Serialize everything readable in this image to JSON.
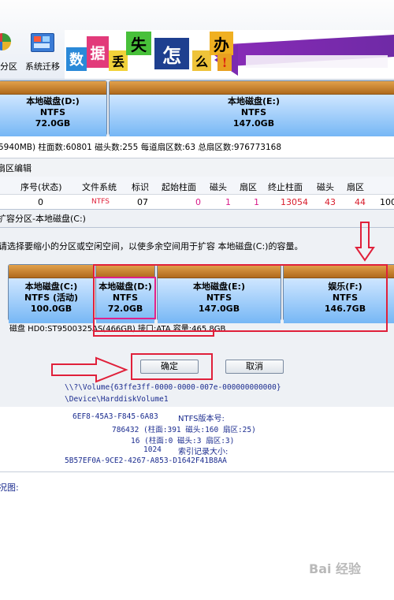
{
  "toolbar": {
    "partition_label": "分区",
    "migrate_label": "系统迁移",
    "banner_chars": [
      "数",
      "据",
      "丢",
      "失",
      "怎",
      "么",
      "办",
      "!"
    ]
  },
  "disk_top": {
    "partitions": [
      {
        "name": "本地磁盘(D:)",
        "fs": "NTFS",
        "size": "72.0GB"
      },
      {
        "name": "本地磁盘(E:)",
        "fs": "NTFS",
        "size": "147.0GB"
      }
    ]
  },
  "disk_info": "5940MB)   柱面数:60801   磁头数:255   每道扇区数:63   总扇区数:976773168",
  "tab_label": "扇区编辑",
  "table": {
    "headers": [
      "序号(状态)",
      "文件系统",
      "标识",
      "起始柱面",
      "磁头",
      "扇区",
      "终止柱面",
      "磁头",
      "扇区"
    ],
    "row": [
      "0",
      "NTFS",
      "07",
      "0",
      "1",
      "1",
      "13054",
      "43",
      "44",
      "100"
    ]
  },
  "dialog": {
    "title": "扩容分区-本地磁盘(C:)",
    "instruction": "请选择要缩小的分区或空闲空间，以使多余空间用于扩容 本地磁盘(C:)的容量。",
    "partitions": [
      {
        "name": "本地磁盘(C:)",
        "fs": "NTFS (活动)",
        "size": "100.0GB"
      },
      {
        "name": "本地磁盘(D:)",
        "fs": "NTFS",
        "size": "72.0GB"
      },
      {
        "name": "本地磁盘(E:)",
        "fs": "NTFS",
        "size": "147.0GB"
      },
      {
        "name": "娱乐(F:)",
        "fs": "NTFS",
        "size": "146.7GB"
      }
    ],
    "disk_line": "磁盘 HD0:ST9500325AS(466GB)   接口:ATA   容量:465.8GB",
    "ok_label": "确定",
    "cancel_label": "取消"
  },
  "info": {
    "volume_guid": "\\\\?\\Volume{63ffe3ff-0000-0000-007e-000000000000}",
    "device": "\\Device\\HarddiskVolume1",
    "serial": "6EF8-45A3-F845-6A83",
    "ntfs_version_label": "NTFS版本号:",
    "mft_pos": "786432 (柱面:391 磁头:160 扇区:25)",
    "mft_mirr": "16 (柱面:0 磁头:3 扇区:3)",
    "index_size": "1024",
    "index_label": "索引记录大小:",
    "guid2": "5B57EF0A-9CE2-4267-A853-D1642F41B8AA",
    "view_label": "况图:"
  },
  "watermark": "Bai 经验",
  "colors": {
    "accent_red": "#e0203a",
    "selection_pink": "#e0208a",
    "part_blue": "#76b7f5",
    "part_cap": "#c07a28"
  }
}
